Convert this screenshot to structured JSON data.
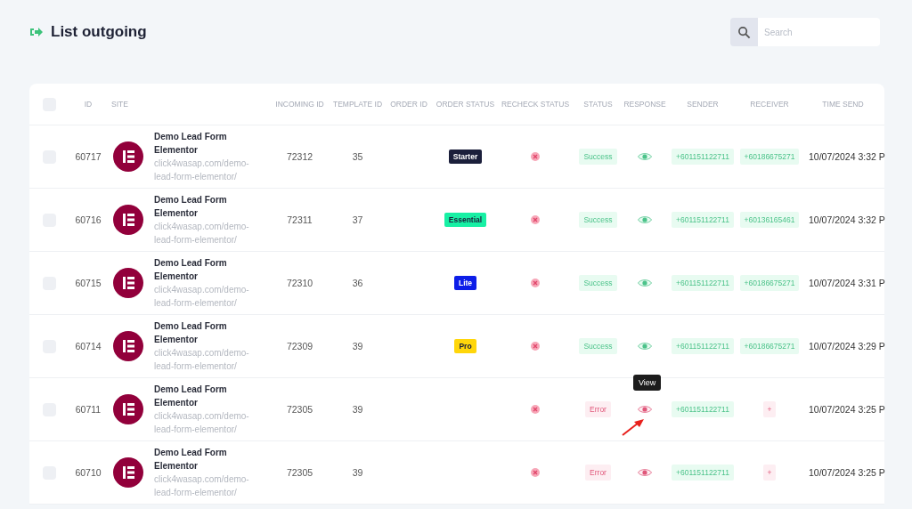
{
  "page": {
    "title": "List outgoing"
  },
  "search": {
    "placeholder": "Search"
  },
  "table": {
    "select_all": {
      "checked": false
    },
    "columns": [
      "ID",
      "SITE",
      "INCOMING ID",
      "TEMPLATE ID",
      "ORDER ID",
      "ORDER STATUS",
      "RECHECK STATUS",
      "STATUS",
      "RESPONSE",
      "SENDER",
      "RECEIVER",
      "TIME SEND"
    ],
    "rows": [
      {
        "checked": false,
        "id": "60717",
        "site_name": "Demo Lead Form Elementor",
        "site_url": "click4wasap.com/demo-lead-form-elementor/",
        "incoming_id": "72312",
        "template_id": "35",
        "order_status": {
          "label": "Starter",
          "color": "#1b1f3b"
        },
        "status": {
          "kind": "success",
          "label": "Success"
        },
        "sender": "+601151122711",
        "receiver": "+60186675271",
        "time_send": "10/07/2024 3:32 P"
      },
      {
        "checked": false,
        "id": "60716",
        "site_name": "Demo Lead Form Elementor",
        "site_url": "click4wasap.com/demo-lead-form-elementor/",
        "incoming_id": "72311",
        "template_id": "37",
        "order_status": {
          "label": "Essential",
          "color": "#17f0a4"
        },
        "status": {
          "kind": "success",
          "label": "Success"
        },
        "sender": "+601151122711",
        "receiver": "+60136165461",
        "time_send": "10/07/2024 3:32 P"
      },
      {
        "checked": false,
        "id": "60715",
        "site_name": "Demo Lead Form Elementor",
        "site_url": "click4wasap.com/demo-lead-form-elementor/",
        "incoming_id": "72310",
        "template_id": "36",
        "order_status": {
          "label": "Lite",
          "color": "#0d1ee8"
        },
        "status": {
          "kind": "success",
          "label": "Success"
        },
        "sender": "+601151122711",
        "receiver": "+60186675271",
        "time_send": "10/07/2024 3:31 P"
      },
      {
        "checked": false,
        "id": "60714",
        "site_name": "Demo Lead Form Elementor",
        "site_url": "click4wasap.com/demo-lead-form-elementor/",
        "incoming_id": "72309",
        "template_id": "39",
        "order_status": {
          "label": "Pro",
          "color": "#ffd60a"
        },
        "status": {
          "kind": "success",
          "label": "Success"
        },
        "sender": "+601151122711",
        "receiver": "+60186675271",
        "time_send": "10/07/2024 3:29 P"
      },
      {
        "checked": false,
        "id": "60711",
        "site_name": "Demo Lead Form Elementor",
        "site_url": "click4wasap.com/demo-lead-form-elementor/",
        "incoming_id": "72305",
        "template_id": "39",
        "status": {
          "kind": "error",
          "label": "Error"
        },
        "response_tooltip": "View",
        "sender": "+601151122711",
        "receiver": "+",
        "time_send": "10/07/2024 3:25 P"
      },
      {
        "checked": false,
        "id": "60710",
        "site_name": "Demo Lead Form Elementor",
        "site_url": "click4wasap.com/demo-lead-form-elementor/",
        "incoming_id": "72305",
        "template_id": "39",
        "status": {
          "kind": "error",
          "label": "Error"
        },
        "sender": "+601151122711",
        "receiver": "+",
        "time_send": "10/07/2024 3:25 P"
      }
    ]
  }
}
